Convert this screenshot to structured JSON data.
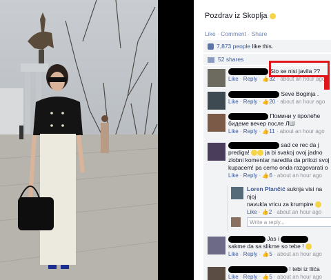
{
  "post": {
    "caption": "Pozdrav iz Skoplja",
    "actions": [
      "Like",
      "Comment",
      "Share"
    ],
    "likes": "7,873 people",
    "likes_suffix": " like this.",
    "shares": "52 shares"
  },
  "comments": [
    {
      "text": "Sto se nisi javila ??",
      "likes": "32",
      "time": "about an hour ago"
    },
    {
      "text": "Seve Boginja .",
      "likes": "20",
      "time": "about an hour ago"
    },
    {
      "text": "Помини у пролеће",
      "text2": "бидеме вечер после ЛШ",
      "likes": "11",
      "time": "about an hour ago"
    },
    {
      "text": "sad ce rec da j",
      "text2": "prediga!",
      "text3": "ja bi svakoj ovoj jadno",
      "text4": "zlobni komentar naredila da prilozi svoj",
      "text5": "kupacem! pa cemo onda razgovarati o",
      "likes": "6",
      "time": "about an hour ago"
    },
    {
      "author": "Loren Plančić",
      "text": "suknja visi na njoj",
      "text2": "navukla vricu za krumpire",
      "likes": "2",
      "time": "about an hour ago",
      "reply": true
    },
    {
      "text": "Jas i",
      "text2": "sakme da sa slikme so tebe !",
      "likes": "5",
      "time": "about an hour ago"
    },
    {
      "text": "! tebi iz Ilića",
      "likes": "5",
      "time": "about an hour ago"
    }
  ],
  "labels": {
    "like": "Like",
    "reply": "Reply",
    "dot": " · ",
    "write_reply": "Write a reply..."
  },
  "colors": {
    "highlight": "#e0161b",
    "link": "#3b5998"
  },
  "icons": [
    "thumbs-up-icon",
    "share-icon",
    "smile-emoji-icon"
  ]
}
